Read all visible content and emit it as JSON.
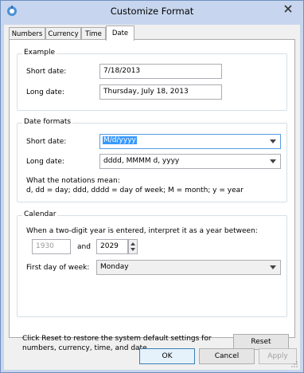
{
  "window": {
    "title": "Customize Format"
  },
  "tabs": [
    {
      "label": "Numbers"
    },
    {
      "label": "Currency"
    },
    {
      "label": "Time"
    },
    {
      "label": "Date",
      "active": true
    }
  ],
  "example": {
    "title": "Example",
    "short_label": "Short date:",
    "short_value": "7/18/2013",
    "long_label": "Long date:",
    "long_value": "Thursday, July 18, 2013"
  },
  "formats": {
    "title": "Date formats",
    "short_label": "Short date:",
    "short_value": "M/d/yyyy",
    "long_label": "Long date:",
    "long_value": "dddd, MMMM d, yyyy",
    "notation_title": "What the notations mean:",
    "notation_text": "d, dd = day;  ddd, dddd = day of week;  M = month;  y = year"
  },
  "calendar": {
    "title": "Calendar",
    "two_digit_text": "When a two-digit year is entered, interpret it as a year between:",
    "year_from": "1930",
    "and_label": "and",
    "year_to": "2029",
    "first_day_label": "First day of week:",
    "first_day_value": "Monday"
  },
  "footer": {
    "reset_text": "Click Reset to restore the system default settings for numbers, currency, time, and date.",
    "reset_label": "Reset",
    "ok_label": "OK",
    "cancel_label": "Cancel",
    "apply_label": "Apply"
  },
  "colors": {
    "title_bar": "#c7d6ee",
    "selection": "#3399ff"
  }
}
